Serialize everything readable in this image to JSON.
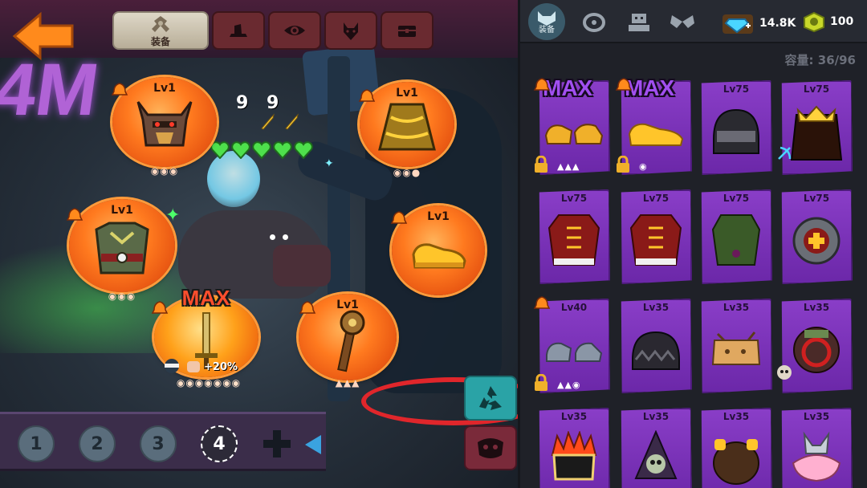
{
  "equip_tabs": [
    {
      "label": "装备",
      "icon": "axe-emblem-icon",
      "active": true
    },
    {
      "label": "",
      "icon": "hat-icon"
    },
    {
      "label": "",
      "icon": "eye-icon"
    },
    {
      "label": "",
      "icon": "wolf-icon"
    },
    {
      "label": "",
      "icon": "chest-icon"
    }
  ],
  "neon_sign": "4M",
  "stats": {
    "attack": "9",
    "defense": "9",
    "hearts": 5
  },
  "slots": {
    "helmet": {
      "level": "Lv1",
      "badges": "◉◉◉"
    },
    "cloak": {
      "level": "Lv1",
      "badges": "◉◉●"
    },
    "armor": {
      "level": "Lv1",
      "badges": "◉◉◉"
    },
    "boots": {
      "level": "Lv1",
      "badges": ""
    },
    "weapon": {
      "level": "MAX",
      "bonus": "+20%",
      "badges": "◉◉◉◉◉◉◉"
    },
    "staff": {
      "level": "Lv1",
      "badges": "▲▲▲"
    }
  },
  "loadouts": [
    "1",
    "2",
    "3",
    "4"
  ],
  "active_loadout": "4",
  "inventory_tabs": [
    {
      "label": "装备",
      "icon": "cat-mask-icon",
      "active": true
    },
    {
      "label": "",
      "icon": "ring-icon"
    },
    {
      "label": "",
      "icon": "robot-icon"
    },
    {
      "label": "",
      "icon": "wings-icon"
    }
  ],
  "currency": {
    "gems": "14.8K",
    "coins": "100"
  },
  "capacity": "容量: 36/96",
  "cards": [
    {
      "level": "MAX",
      "item": "gold-gauntlets-icon",
      "locked": true,
      "bell": true,
      "runes": "▲▲▲"
    },
    {
      "level": "MAX",
      "item": "gold-boots-icon",
      "locked": true,
      "bell": true,
      "runes": "◉"
    },
    {
      "level": "Lv75",
      "item": "black-helmet-icon"
    },
    {
      "level": "Lv75",
      "item": "gold-crown-cape-icon",
      "tag": true
    },
    {
      "level": "Lv75",
      "item": "red-coat-icon"
    },
    {
      "level": "Lv75",
      "item": "red-coat-icon"
    },
    {
      "level": "Lv75",
      "item": "green-tunic-icon"
    },
    {
      "level": "Lv75",
      "item": "cross-shield-icon"
    },
    {
      "level": "Lv40",
      "item": "gray-boots-icon",
      "locked": true,
      "bell": true,
      "runes": "▲▲◉"
    },
    {
      "level": "Lv35",
      "item": "dark-helmet-icon"
    },
    {
      "level": "Lv35",
      "item": "box-hat-icon"
    },
    {
      "level": "Lv35",
      "item": "ring-mask-icon",
      "tag": true
    },
    {
      "level": "Lv35",
      "item": "flame-mask-icon"
    },
    {
      "level": "Lv35",
      "item": "skull-hood-icon"
    },
    {
      "level": "Lv35",
      "item": "furry-gloves-icon"
    },
    {
      "level": "Lv35",
      "item": "pink-tutu-icon"
    }
  ],
  "colors": {
    "slot_orange": "#ff7a1f",
    "card_purple": "#8a3ec8",
    "max_red": "#ff4e2d",
    "recycle_teal": "#2aa3a6",
    "accent_gold": "#ffd23c"
  }
}
